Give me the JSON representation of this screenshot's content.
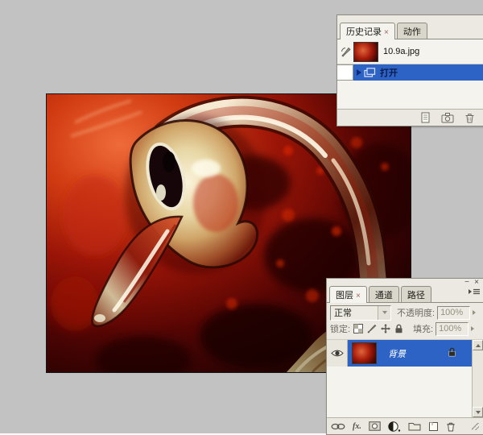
{
  "app": {
    "name": "Photoshop workspace (Chinese)"
  },
  "colors": {
    "desktop_bg": "#c2c2c2",
    "panel_bg": "#ece9e2",
    "selection_blue": "#2e63c6",
    "tab_active_bg": "#f4f3ed",
    "tab_inactive_bg": "#d9d6cb",
    "canvas_border": "#151515"
  },
  "document": {
    "title": "10.9a.jpg",
    "content": "red glass swan photo"
  },
  "history_panel": {
    "tabs": [
      {
        "label": "历史记录",
        "close_label": "×",
        "active": true
      },
      {
        "label": "动作",
        "active": false
      }
    ],
    "snapshot_label": "10.9a.jpg",
    "state_open_label": "打开",
    "footer_icons": [
      "new-document-from-state",
      "new-snapshot",
      "delete-state"
    ]
  },
  "layers_panel": {
    "minimize_label": "−",
    "close_label": "×",
    "tabs": [
      {
        "label": "图层",
        "close_label": "×",
        "active": true
      },
      {
        "label": "通道",
        "active": false
      },
      {
        "label": "路径",
        "active": false
      }
    ],
    "blend_mode_value": "正常",
    "opacity_label": "不透明度:",
    "opacity_value": "100%",
    "lock_label": "锁定:",
    "lock_icons": [
      "lock-transparency",
      "lock-paint",
      "lock-position",
      "lock-all"
    ],
    "fill_label": "填充:",
    "fill_value": "100%",
    "layers": [
      {
        "name": "背景",
        "visible": true,
        "locked": true,
        "selected": true
      }
    ],
    "fx_label": "fx.",
    "footer_icons": [
      "link-layers",
      "layer-style",
      "add-layer-mask",
      "new-adjustment-layer",
      "new-group",
      "new-layer",
      "delete-layer"
    ]
  }
}
